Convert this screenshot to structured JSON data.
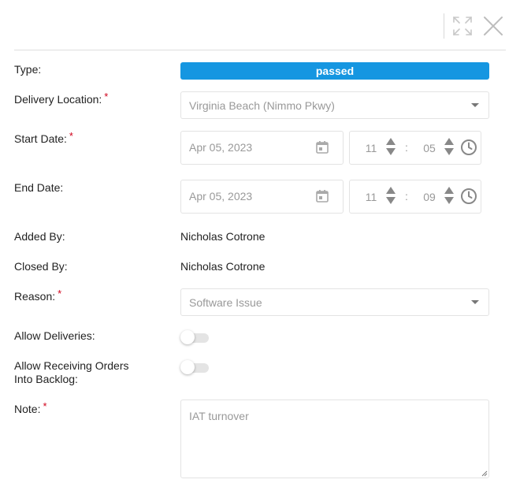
{
  "header": {
    "expand_icon": "expand-icon",
    "close_icon": "close-icon"
  },
  "form": {
    "type": {
      "label": "Type:",
      "value": "passed",
      "badge_color": "#1596e1"
    },
    "delivery_location": {
      "label": "Delivery Location:",
      "required": "*",
      "value": "Virginia Beach (Nimmo Pkwy)"
    },
    "start_date": {
      "label": "Start Date:",
      "required": "*",
      "date": "Apr 05, 2023",
      "hour": "11",
      "separator": ":",
      "minute": "05"
    },
    "end_date": {
      "label": "End Date:",
      "date": "Apr 05, 2023",
      "hour": "11",
      "separator": ":",
      "minute": "09"
    },
    "added_by": {
      "label": "Added By:",
      "value": "Nicholas Cotrone"
    },
    "closed_by": {
      "label": "Closed By:",
      "value": "Nicholas Cotrone"
    },
    "reason": {
      "label": "Reason:",
      "required": "*",
      "value": "Software Issue"
    },
    "allow_deliveries": {
      "label": "Allow Deliveries:",
      "enabled": false
    },
    "allow_backlog": {
      "label_line1": "Allow Receiving Orders",
      "label_line2": "Into Backlog:",
      "enabled": false
    },
    "note": {
      "label": "Note:",
      "required": "*",
      "value": "IAT turnover"
    }
  },
  "colors": {
    "required": "#d0021b",
    "badge": "#1596e1",
    "border": "#e3e3e3",
    "muted_text": "#999999"
  }
}
